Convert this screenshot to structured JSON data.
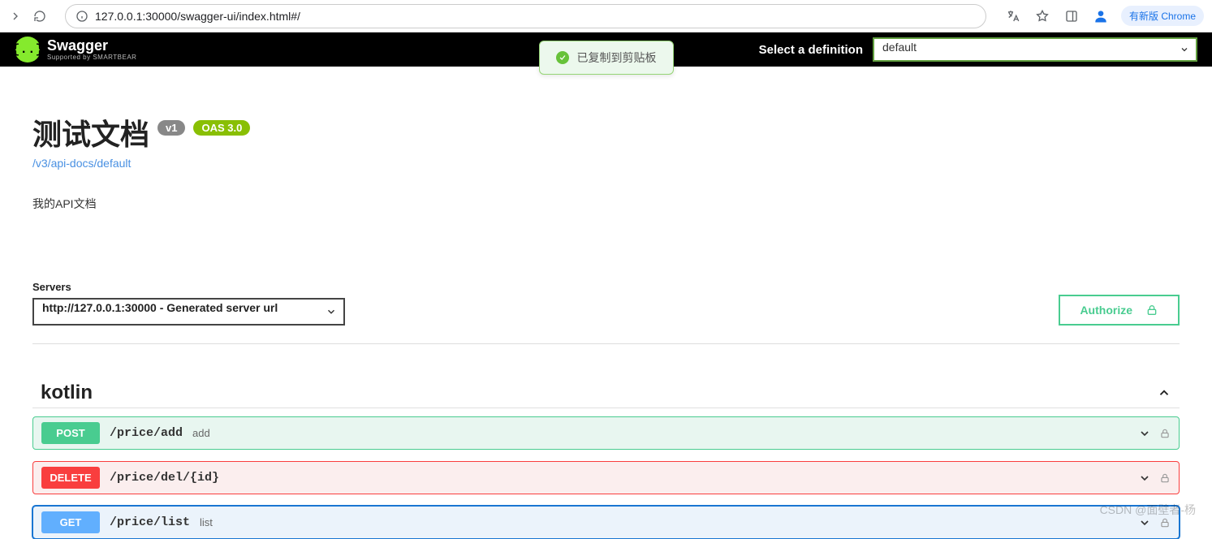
{
  "browser": {
    "url": "127.0.0.1:30000/swagger-ui/index.html#/",
    "update_badge": "有新版 Chrome"
  },
  "toast": {
    "text": "已复制到剪贴板"
  },
  "topbar": {
    "logo_title": "Swagger",
    "logo_sub": "Supported by SMARTBEAR",
    "select_label": "Select a definition",
    "definition": "default"
  },
  "info": {
    "title": "测试文档",
    "version_badge": "v1",
    "oas_badge": "OAS 3.0",
    "docs_link": "/v3/api-docs/default",
    "description": "我的API文档"
  },
  "servers": {
    "label": "Servers",
    "selected": "http://127.0.0.1:30000 - Generated server url"
  },
  "authorize_label": "Authorize",
  "tag": {
    "name": "kotlin"
  },
  "ops": [
    {
      "method": "POST",
      "path": "/price/add",
      "summary": "add"
    },
    {
      "method": "DELETE",
      "path": "/price/del/{id}",
      "summary": ""
    },
    {
      "method": "GET",
      "path": "/price/list",
      "summary": "list"
    }
  ],
  "watermark": "CSDN @面壁者-杨"
}
